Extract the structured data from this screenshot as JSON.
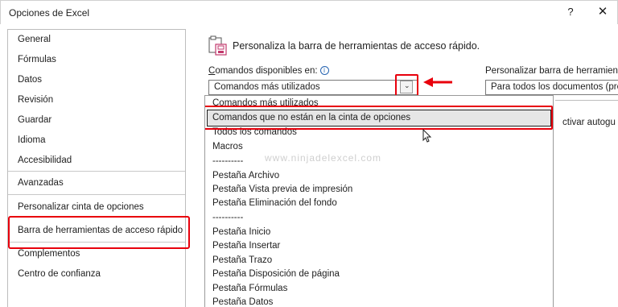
{
  "window": {
    "title": "Opciones de Excel",
    "help_label": "?",
    "close_label": "✕"
  },
  "sidebar": {
    "items": [
      {
        "label": "General"
      },
      {
        "label": "Fórmulas"
      },
      {
        "label": "Datos"
      },
      {
        "label": "Revisión"
      },
      {
        "label": "Guardar"
      },
      {
        "label": "Idioma"
      },
      {
        "label": "Accesibilidad"
      },
      {
        "label": "Avanzadas"
      },
      {
        "label": "Personalizar cinta de opciones"
      },
      {
        "label": "Barra de herramientas de acceso rápido"
      },
      {
        "label": "Complementos"
      },
      {
        "label": "Centro de confianza"
      }
    ],
    "selected_index": 9
  },
  "main": {
    "heading": "Personaliza la barra de herramientas de acceso rápido.",
    "commands_label_underlined": "C",
    "commands_label_rest": "omandos disponibles en:",
    "info_icon_glyph": "i",
    "combo_value": "Comandos más utilizados",
    "combo_arrow": "⌄",
    "right_label": "Personalizar barra de herramienta",
    "right_combo_value": "Para todos los documentos (pre",
    "right_partial_text": "ctivar autogu"
  },
  "dropdown": {
    "items": [
      "Comandos más utilizados",
      "Comandos que no están en la cinta de opciones",
      "Todos los comandos",
      "Macros",
      "----------",
      "Pestaña Archivo",
      "Pestaña Vista previa de impresión",
      "Pestaña Eliminación del fondo",
      "----------",
      "Pestaña Inicio",
      "Pestaña Insertar",
      "Pestaña Trazo",
      "Pestaña Disposición de página",
      "Pestaña Fórmulas",
      "Pestaña Datos"
    ],
    "hovered_index": 1
  },
  "watermark": "www.ninjadelexcel.com",
  "colors": {
    "highlight_red": "#e8000c",
    "accent_blue": "#2563b0",
    "hover_gray": "#e6e6e6"
  }
}
